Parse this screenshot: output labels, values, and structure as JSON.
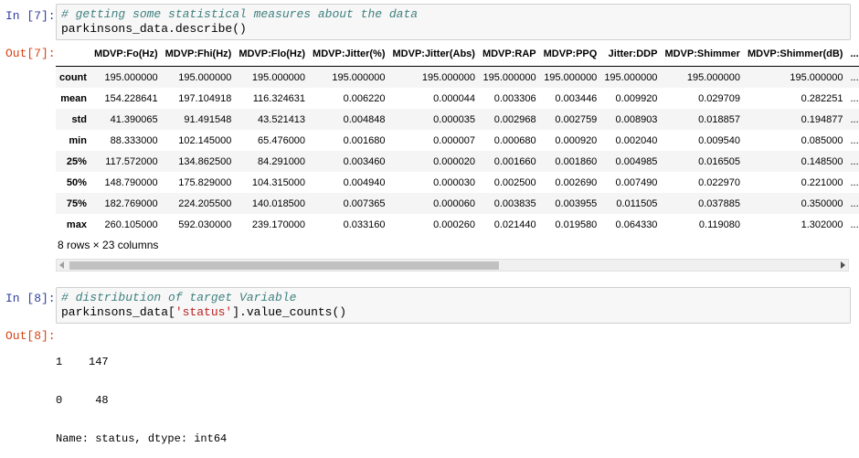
{
  "cells": {
    "in7": {
      "prompt": "In [7]:",
      "comment": "# getting some statistical measures about the data",
      "code": "parkinsons_data.describe()"
    },
    "out7": {
      "prompt": "Out[7]:",
      "table": {
        "columns": [
          "",
          "MDVP:Fo(Hz)",
          "MDVP:Fhi(Hz)",
          "MDVP:Flo(Hz)",
          "MDVP:Jitter(%)",
          "MDVP:Jitter(Abs)",
          "MDVP:RAP",
          "MDVP:PPQ",
          "Jitter:DDP",
          "MDVP:Shimmer",
          "MDVP:Shimmer(dB)",
          "..."
        ],
        "rows": [
          [
            "count",
            "195.000000",
            "195.000000",
            "195.000000",
            "195.000000",
            "195.000000",
            "195.000000",
            "195.000000",
            "195.000000",
            "195.000000",
            "195.000000",
            "..."
          ],
          [
            "mean",
            "154.228641",
            "197.104918",
            "116.324631",
            "0.006220",
            "0.000044",
            "0.003306",
            "0.003446",
            "0.009920",
            "0.029709",
            "0.282251",
            "..."
          ],
          [
            "std",
            "41.390065",
            "91.491548",
            "43.521413",
            "0.004848",
            "0.000035",
            "0.002968",
            "0.002759",
            "0.008903",
            "0.018857",
            "0.194877",
            "..."
          ],
          [
            "min",
            "88.333000",
            "102.145000",
            "65.476000",
            "0.001680",
            "0.000007",
            "0.000680",
            "0.000920",
            "0.002040",
            "0.009540",
            "0.085000",
            "..."
          ],
          [
            "25%",
            "117.572000",
            "134.862500",
            "84.291000",
            "0.003460",
            "0.000020",
            "0.001660",
            "0.001860",
            "0.004985",
            "0.016505",
            "0.148500",
            "..."
          ],
          [
            "50%",
            "148.790000",
            "175.829000",
            "104.315000",
            "0.004940",
            "0.000030",
            "0.002500",
            "0.002690",
            "0.007490",
            "0.022970",
            "0.221000",
            "..."
          ],
          [
            "75%",
            "182.769000",
            "224.205500",
            "140.018500",
            "0.007365",
            "0.000060",
            "0.003835",
            "0.003955",
            "0.011505",
            "0.037885",
            "0.350000",
            "..."
          ],
          [
            "max",
            "260.105000",
            "592.030000",
            "239.170000",
            "0.033160",
            "0.000260",
            "0.021440",
            "0.019580",
            "0.064330",
            "0.119080",
            "1.302000",
            "..."
          ]
        ]
      },
      "shape_text": "8 rows × 23 columns"
    },
    "in8": {
      "prompt": "In [8]:",
      "comment": "# distribution of target Variable",
      "code_pre": "parkinsons_data[",
      "code_str": "'status'",
      "code_post": "].value_counts()"
    },
    "out8": {
      "prompt": "Out[8]:",
      "lines": [
        "1    147",
        "0     48",
        "Name: status, dtype: int64"
      ]
    }
  }
}
